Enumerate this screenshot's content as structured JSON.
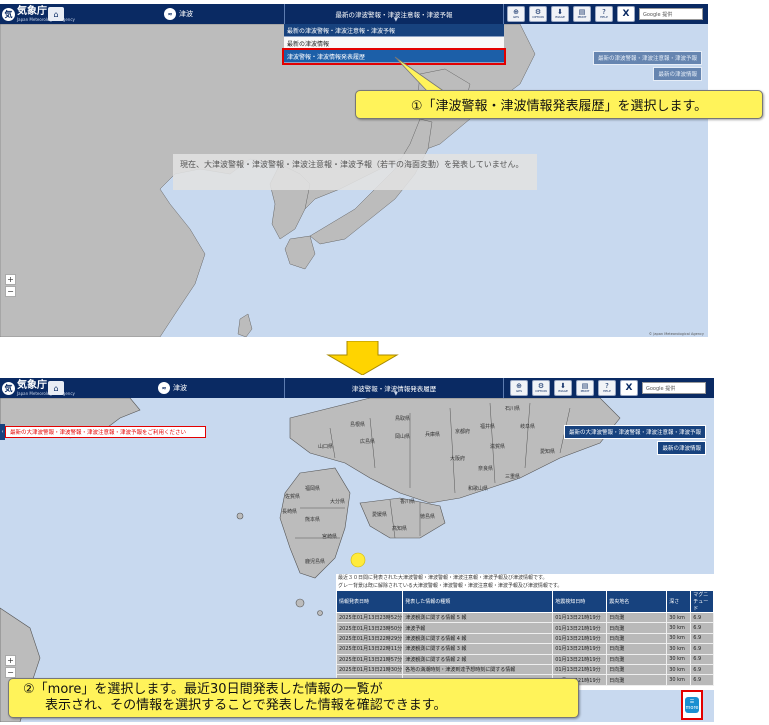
{
  "colors": {
    "header_navy": "#0a2a63",
    "menu_blue": "#17427e",
    "selected_blue": "#1c5fa8",
    "highlight_red": "#e30000",
    "callout_yellow": "#fff35a",
    "sea": "#c8d9ef",
    "land": "#bcbcbc",
    "epicenter": "#ffeb3b"
  },
  "header": {
    "agency_name": "気象庁",
    "agency_sub": "Japan Meteorological Agency",
    "home_icon": "home-icon",
    "mode_label": "津波"
  },
  "tools": [
    {
      "icon": "gps-icon",
      "label": "GPS"
    },
    {
      "icon": "gear-icon",
      "label": "OPTION"
    },
    {
      "icon": "download-icon",
      "label": "IMAGE"
    },
    {
      "icon": "print-icon",
      "label": "PRINT"
    },
    {
      "icon": "help-icon",
      "label": "HELP"
    },
    {
      "icon": "x-icon",
      "label": "X"
    }
  ],
  "search": {
    "placeholder": "Google 提供"
  },
  "shot1": {
    "selector_label": "最新の津波警報・津波注意報・津波予報",
    "dropdown": [
      "最新の津波警報・津波注意報・津波予報",
      "最新の津波情報",
      "津波警報・津波情報発表履歴"
    ],
    "side_links": [
      "最新の津波警報・津波注意報・津波予報",
      "最新の津波情報"
    ],
    "status_message": "現在、大津波警報・津波警報・津波注意報・津波予報（若干の海面変動）を発表していません。",
    "zoom": [
      "+",
      "−"
    ],
    "copyright": "© Japan Meteorological Agency"
  },
  "callout1": "①「津波警報・津波情報発表履歴」を選択します。",
  "shot2": {
    "selector_label": "津波警報・津波情報発表履歴",
    "alert_banner": "最新の大津波警報・津波警報・津波注意報・津波予報をご利用ください",
    "side_links": [
      "最新の大津波警報・津波警報・津波注意報・津波予報",
      "最新の津波情報"
    ],
    "prefectures": [
      "福岡県",
      "佐賀県",
      "長崎県",
      "熊本県",
      "大分県",
      "宮崎県",
      "鹿児島県",
      "山口県",
      "広島県",
      "岡山県",
      "島根県",
      "鳥取県",
      "兵庫県",
      "京都府",
      "大阪府",
      "奈良県",
      "和歌山県",
      "三重県",
      "滋賀県",
      "香川県",
      "徳島県",
      "愛媛県",
      "高知県",
      "福井県",
      "岐阜県",
      "愛知県",
      "石川県"
    ],
    "panel_note": [
      "最近３０日間に発表された大津波警報・津波警報・津波注意報・津波予報及び津波情報です。",
      "グレー背景は既に解除されている大津波警報・津波警報・津波注意報・津波予報及び津波情報です。"
    ],
    "table": {
      "headers": [
        "情報発表日時",
        "発表した情報の種類",
        "地震検知日時",
        "震央地名",
        "深さ",
        "マグニチュード"
      ],
      "rows": [
        [
          "2025年01月13日23時52分",
          "津波観測に関する情報 5 報",
          "01月13日21時19分",
          "日向灘",
          "30 km",
          "6.9"
        ],
        [
          "2025年01月13日23時50分",
          "津波予報",
          "01月13日21時19分",
          "日向灘",
          "30 km",
          "6.9"
        ],
        [
          "2025年01月13日22時29分",
          "津波観測に関する情報 4 報",
          "01月13日21時19分",
          "日向灘",
          "30 km",
          "6.9"
        ],
        [
          "2025年01月13日22時11分",
          "津波観測に関する情報 3 報",
          "01月13日21時19分",
          "日向灘",
          "30 km",
          "6.9"
        ],
        [
          "2025年01月13日21時57分",
          "津波観測に関する情報 2 報",
          "01月13日21時19分",
          "日向灘",
          "30 km",
          "6.9"
        ],
        [
          "2025年01月13日21時30分",
          "各地の満潮時刻・津波到達予想時刻に関する情報",
          "01月13日21時19分",
          "日向灘",
          "30 km",
          "6.9"
        ],
        [
          "",
          "",
          "01月13日21時19分",
          "日向灘",
          "30 km",
          "6.9"
        ]
      ]
    },
    "zoom": [
      "+",
      "−"
    ],
    "more_label": "more"
  },
  "callout2": {
    "line1": "②「more」を選択します。最近30日間発表した情報の一覧が",
    "line2": "表示され、その情報を選択することで発表した情報を確認できます。"
  }
}
